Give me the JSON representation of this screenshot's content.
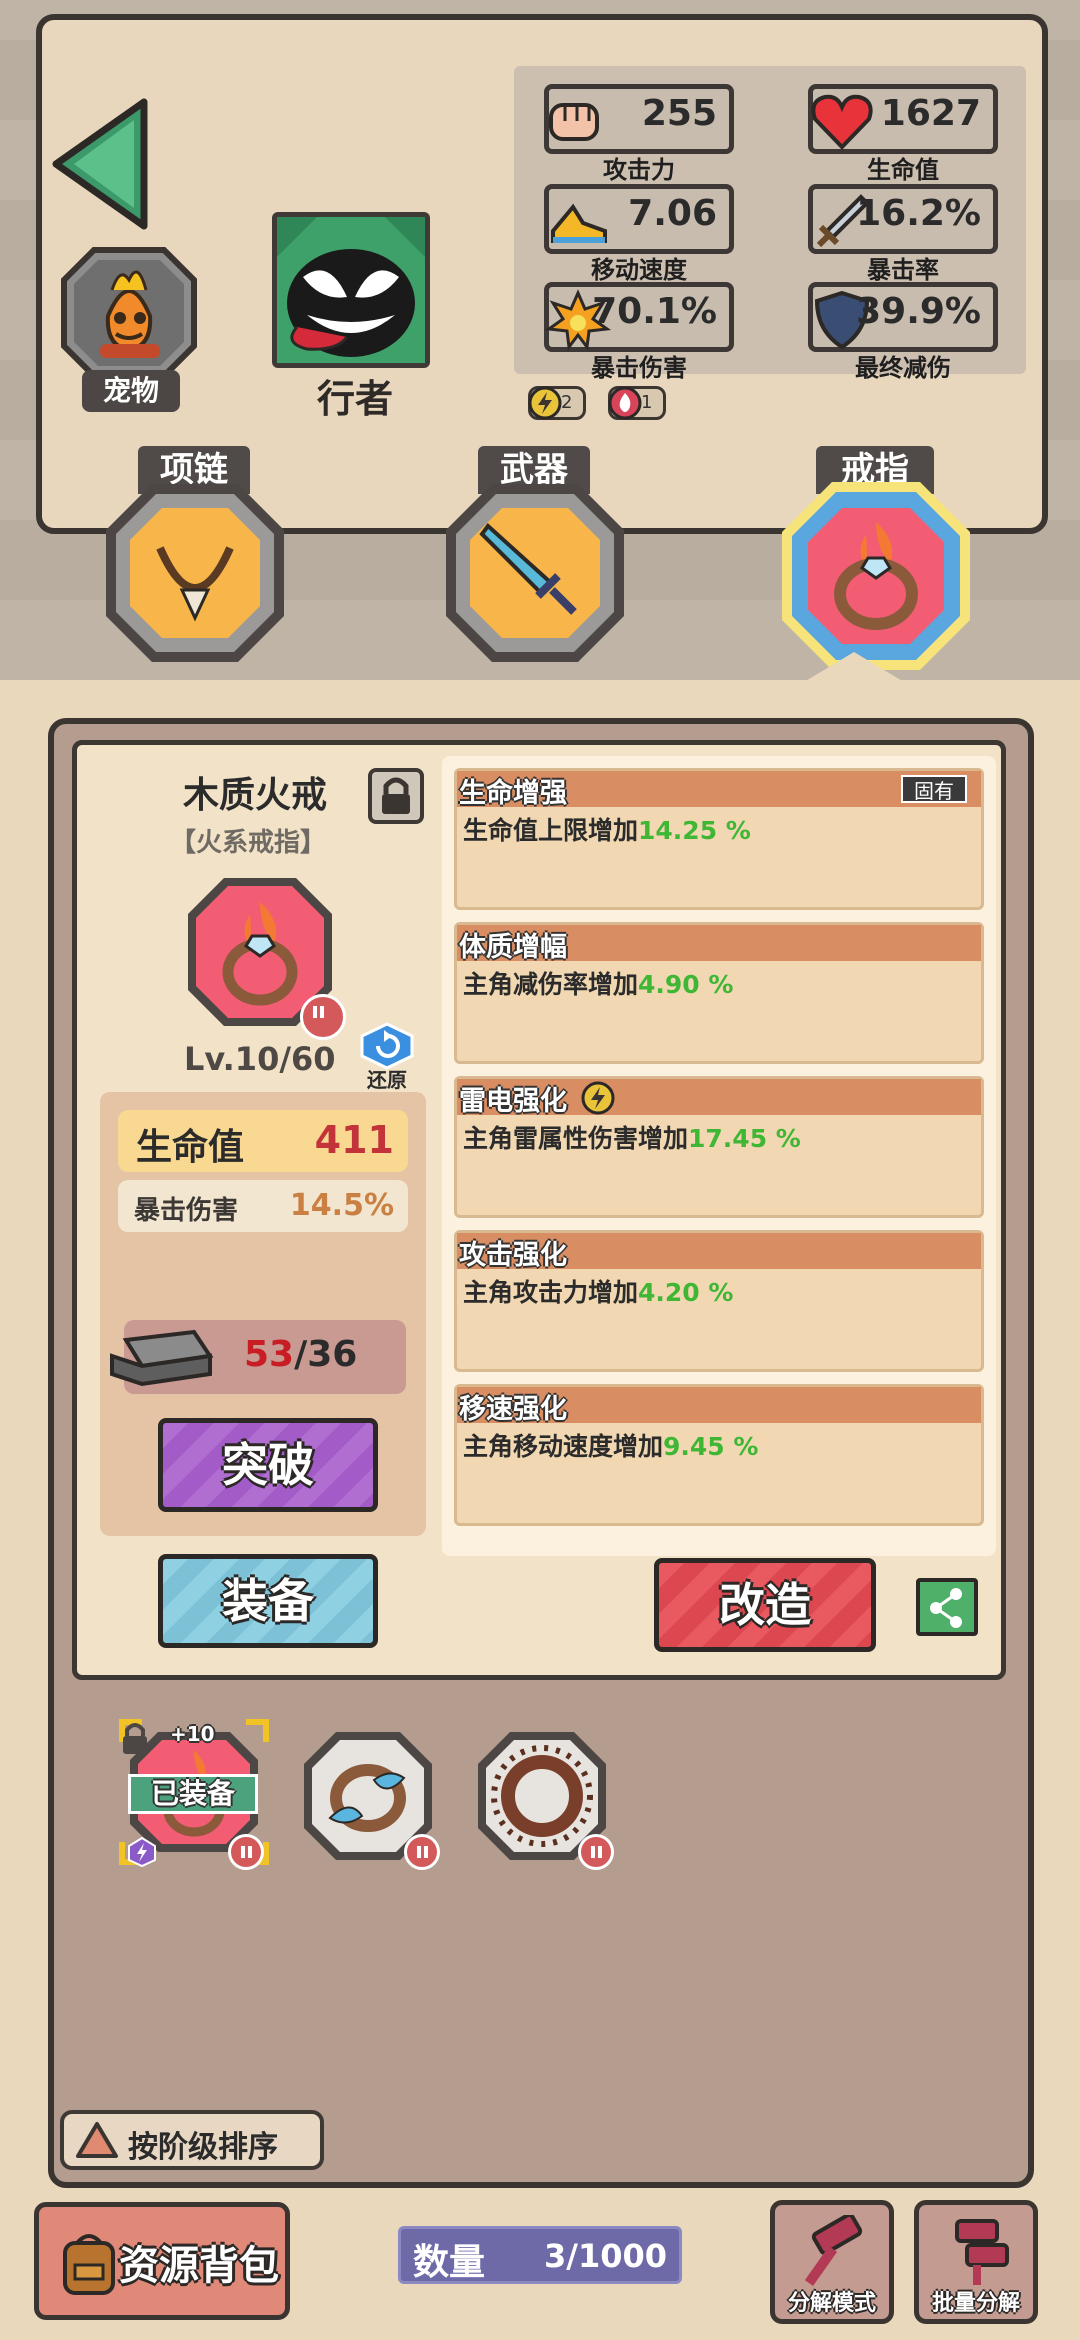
{
  "header": {
    "pet_label": "宠物",
    "hero_label": "行者",
    "stats": [
      {
        "icon": "fist-icon",
        "value": "255",
        "label": "攻击力"
      },
      {
        "icon": "heart-icon",
        "value": "1627",
        "label": "生命值"
      },
      {
        "icon": "shoe-icon",
        "value": "7.06",
        "label": "移动速度"
      },
      {
        "icon": "sword-icon",
        "value": "16.2%",
        "label": "暴击率"
      },
      {
        "icon": "explosion-icon",
        "value": "70.1%",
        "label": "暴击伤害"
      },
      {
        "icon": "shield-icon",
        "value": "39.9%",
        "label": "最终减伤"
      }
    ],
    "badges": [
      {
        "icon": "lightning-icon",
        "count": "2"
      },
      {
        "icon": "fire-icon",
        "count": "1"
      }
    ]
  },
  "slots": [
    {
      "label": "项链",
      "icon": "necklace-icon"
    },
    {
      "label": "武器",
      "icon": "sword-icon"
    },
    {
      "label": "戒指",
      "icon": "fire-ring-icon",
      "selected": true
    }
  ],
  "item": {
    "name": "木质火戒",
    "type": "【火系戒指】",
    "level": "Lv.10/60",
    "restore_label": "还原",
    "main_stat": {
      "label": "生命值",
      "value": "411"
    },
    "sub_stat": {
      "label": "暴击伤害",
      "value": "14.5%"
    },
    "material": {
      "have": "53",
      "need": "/36"
    },
    "break_label": "突破",
    "equip_label": "装备",
    "remake_label": "改造"
  },
  "affixes": [
    {
      "title": "生命增强",
      "desc": "生命值上限增加",
      "value": "14.25 %",
      "tag": "固有"
    },
    {
      "title": "体质增幅",
      "desc": "主角减伤率增加",
      "value": "4.90 %"
    },
    {
      "title": "雷电强化",
      "desc": "主角雷属性伤害增加",
      "value": "17.45 %",
      "icon": "lightning-icon"
    },
    {
      "title": "攻击强化",
      "desc": "主角攻击力增加",
      "value": "4.20 %"
    },
    {
      "title": "移速强化",
      "desc": "主角移动速度增加",
      "value": "9.45 %"
    }
  ],
  "inventory": [
    {
      "icon": "fire-ring-icon",
      "equipped_label": "已装备",
      "enhance": "+10",
      "locked": true
    },
    {
      "icon": "water-ring-icon"
    },
    {
      "icon": "spike-ring-icon"
    }
  ],
  "sort_label": "按阶级排序",
  "footer": {
    "bag_label": "资源背包",
    "count_label": "数量",
    "count_value": "3/1000",
    "decompose_mode_label": "分解模式",
    "batch_decompose_label": "批量分解"
  },
  "colors": {
    "green_value": "#3fb735",
    "red_value": "#c3343a",
    "affix_header": "#d98d62",
    "selected_slot": "#f25d74"
  }
}
